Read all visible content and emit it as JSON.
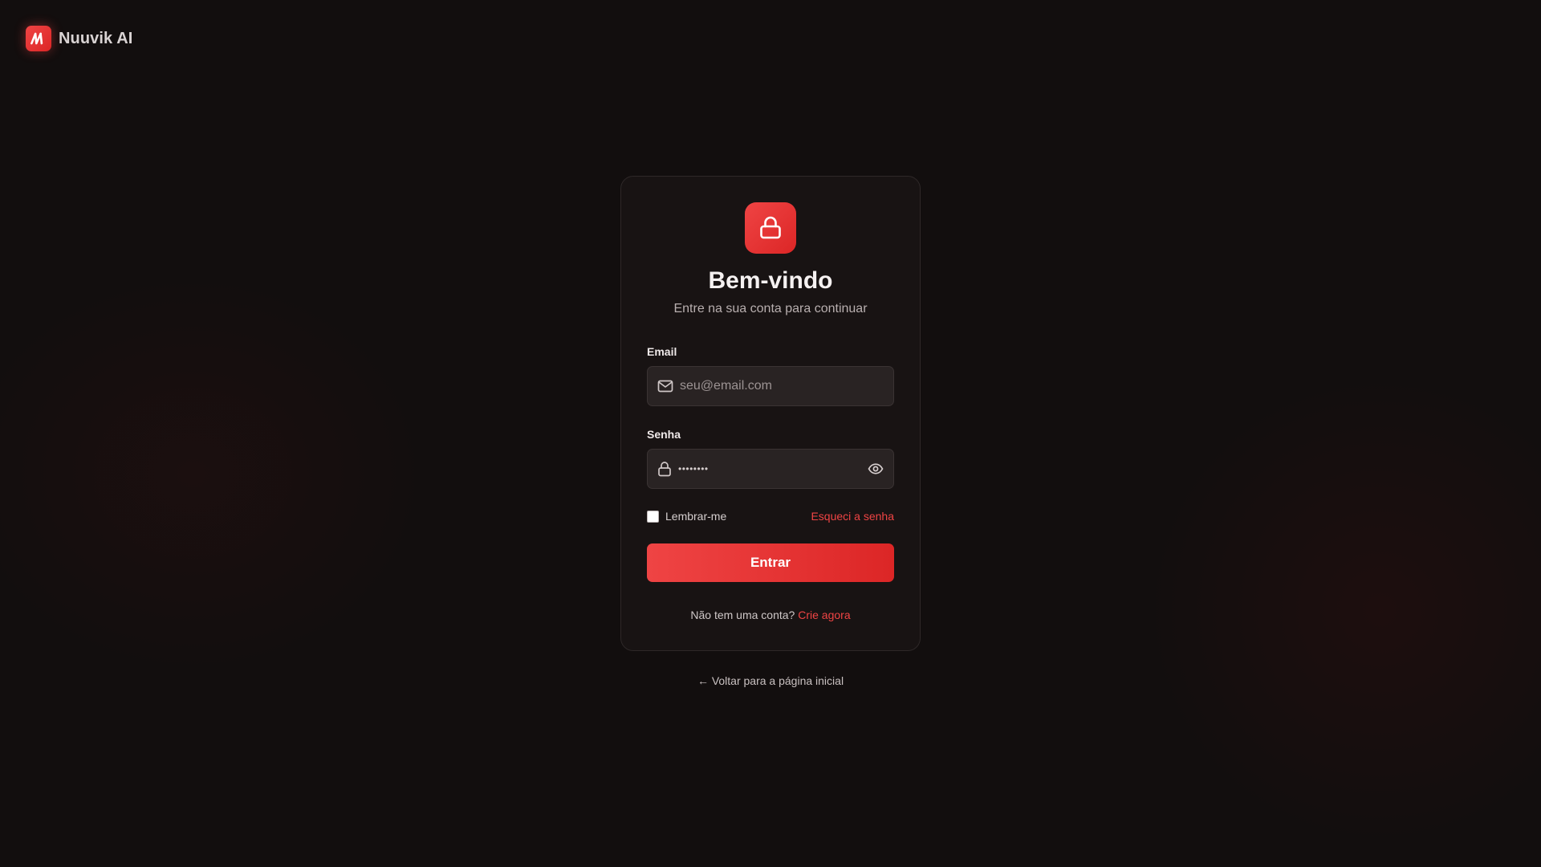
{
  "brand": {
    "name": "Nuuvik AI",
    "logo_icon": "nuuvik-logo-icon",
    "accent_color": "#ef4444"
  },
  "login": {
    "badge_icon": "lock-icon",
    "title": "Bem-vindo",
    "subtitle": "Entre na sua conta para continuar",
    "email": {
      "label": "Email",
      "placeholder": "seu@email.com",
      "value": "",
      "icon": "mail-icon"
    },
    "password": {
      "label": "Senha",
      "masked_value": "••••••••",
      "icon": "lock-icon",
      "toggle_icon": "eye-icon"
    },
    "remember_label": "Lembrar-me",
    "remember_checked": false,
    "forgot_label": "Esqueci a senha",
    "submit_label": "Entrar",
    "signup_prompt": "Não tem uma conta?",
    "signup_link": "Crie agora"
  },
  "back_link": {
    "arrow": "←",
    "label": "Voltar para a página inicial"
  }
}
